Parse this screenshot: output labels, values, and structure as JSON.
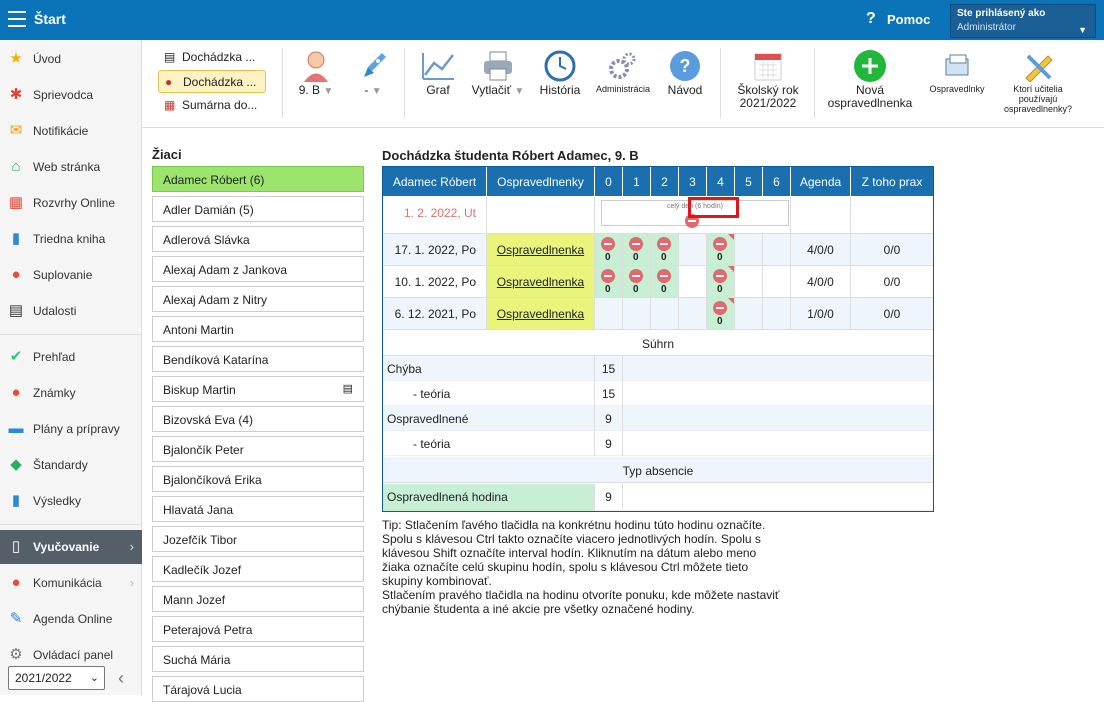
{
  "topbar": {
    "title": "Štart",
    "help_label": "Pomoc",
    "user_line1": "Ste prihlásený ako",
    "user_line2": "Administrátor"
  },
  "sidebar": {
    "items": [
      {
        "label": "Úvod",
        "icon": "star-icon",
        "color": "#f2b100"
      },
      {
        "label": "Sprievodca",
        "icon": "wand-icon",
        "color": "#e0433b"
      },
      {
        "label": "Notifikácie",
        "icon": "envelope-icon",
        "color": "#f39c12"
      },
      {
        "label": "Web stránka",
        "icon": "home-icon",
        "color": "#27ae60"
      },
      {
        "label": "Rozvrhy Online",
        "icon": "calendar-grid-icon",
        "color": "#e74c3c"
      },
      {
        "label": "Triedna kniha",
        "icon": "book-icon",
        "color": "#2d88d3"
      },
      {
        "label": "Suplovanie",
        "icon": "person-swap-icon",
        "color": "#e74c3c"
      },
      {
        "label": "Udalosti",
        "icon": "calendar-icon",
        "color": "#333333"
      },
      {
        "label": "Prehľad",
        "icon": "check-circle-icon",
        "color": "#2ecc71"
      },
      {
        "label": "Známky",
        "icon": "grade-icon",
        "color": "#e74c3c"
      },
      {
        "label": "Plány a prípravy",
        "icon": "briefcase-icon",
        "color": "#2d88d3"
      },
      {
        "label": "Štandardy",
        "icon": "shield-check-icon",
        "color": "#27ae60"
      },
      {
        "label": "Výsledky",
        "icon": "bar-chart-icon",
        "color": "#2d88d3"
      },
      {
        "label": "Vyučovanie",
        "icon": "open-book-icon",
        "color": "#ffffff"
      },
      {
        "label": "Komunikácia",
        "icon": "chat-icon",
        "color": "#e74c3c"
      },
      {
        "label": "Agenda Online",
        "icon": "pen-icon",
        "color": "#2d88d3"
      },
      {
        "label": "Ovládací panel",
        "icon": "gear-icon",
        "color": "#777777"
      }
    ],
    "year_select": "2021/2022"
  },
  "toolbar": {
    "attendance_items": [
      "Dochádzka ...",
      "Dochádzka ...",
      "Sumárna do..."
    ],
    "class_select": "9. B",
    "group_select": "-",
    "graf": "Graf",
    "vytlacit": "Vytlačiť",
    "historia": "História",
    "administracia": "Administrácia",
    "navod": "Návod",
    "skolsky_rok_line1": "Školský rok",
    "skolsky_rok_line2": "2021/2022",
    "nova_line1": "Nová",
    "nova_line2": "ospravedlnenka",
    "ospravedlnky": "Ospravedlnky",
    "ktori_line1": "Ktorí učitelia",
    "ktori_line2": "používajú",
    "ktori_line3": "ospravedlnenky?"
  },
  "students": {
    "heading": "Žiaci",
    "list": [
      "Adamec Róbert (6)",
      "Adler Damián (5)",
      "Adlerová Slávka",
      "Alexaj Adam z Jankova",
      "Alexaj Adam z Nitry",
      "Antoni Martin",
      "Bendíková Katarína",
      "Biskup Martin",
      "Bizovská Eva (4)",
      "Bjalončík Peter",
      "Bjalončíková Erika",
      "Hlavatá Jana",
      "Jozefčík Tibor",
      "Kadlečík Jozef",
      "Mann Jozef",
      "Peterajová Petra",
      "Suchá Mária",
      "Tárajová Lucia"
    ]
  },
  "attendance": {
    "title": "Dochádzka študenta Róbert Adamec, 9. B",
    "headers": [
      "Adamec Róbert",
      "Ospravedlnenky",
      "0",
      "1",
      "2",
      "3",
      "4",
      "5",
      "6",
      "Agenda",
      "Z toho prax"
    ],
    "tooltip": "celý deň (6 hodín)",
    "first_date": "1. 2. 2022, Ut",
    "rows": [
      {
        "date": "17. 1. 2022, Po",
        "link": "Ospravedlnenka",
        "agenda": "4/0/0",
        "prax": "0/0"
      },
      {
        "date": "10. 1. 2022, Po",
        "link": "Ospravedlnenka",
        "agenda": "4/0/0",
        "prax": "0/0"
      },
      {
        "date": "6. 12. 2021, Po",
        "link": "Ospravedlnenka",
        "agenda": "1/0/0",
        "prax": "0/0"
      }
    ],
    "absence_count": "0",
    "summary_heading": "Súhrn",
    "summary": [
      {
        "label": "Chýba",
        "value": "15"
      },
      {
        "label": "- teória",
        "value": "15"
      },
      {
        "label": "Ospravedlnené",
        "value": "9"
      },
      {
        "label": "- teória",
        "value": "9"
      }
    ],
    "type_heading": "Typ absencie",
    "type_row": {
      "label": "Ospravedlnená hodina",
      "value": "9"
    }
  },
  "tip": "Tip: Stlačením ľavého tlačidla na konkrétnu hodinu túto hodinu označíte. Spolu s klávesou Ctrl takto označíte viacero jednotlivých hodín. Spolu s klávesou Shift označíte interval hodín. Kliknutím na dátum alebo meno žiaka označíte celú skupinu hodín, spolu s klávesou Ctrl môžete tieto skupiny kombinovať.",
  "tip2": "Stlačením pravého tlačidla na hodinu otvoríte ponuku, kde môžete nastaviť chýbanie študenta a iné akcie pre všetky označené hodiny."
}
